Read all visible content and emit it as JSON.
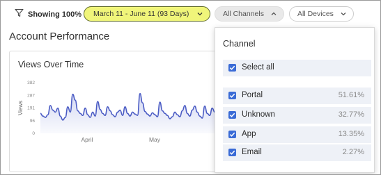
{
  "toolbar": {
    "filter_label": "Showing 100%",
    "date_range": "March 11 - June 11 (93 Days)",
    "channels_label": "All Channels",
    "devices_label": "All Devices"
  },
  "account_performance": {
    "title": "Account Performance"
  },
  "views_card": {
    "title": "Views Over Time"
  },
  "channel_dropdown": {
    "heading": "Channel",
    "select_all_label": "Select all",
    "options": [
      {
        "label": "Portal",
        "percent": "51.61%"
      },
      {
        "label": "Unknown",
        "percent": "32.77%"
      },
      {
        "label": "App",
        "percent": "13.35%"
      },
      {
        "label": "Email",
        "percent": "2.27%"
      }
    ]
  },
  "colors": {
    "date_pill_bg": "#f0f57a",
    "line": "#4a5bc4",
    "checkbox": "#3a6bd6"
  },
  "chart_data": {
    "type": "area",
    "title": "Views Over Time",
    "ylabel": "Views",
    "ytick_labels": [
      "382",
      "287",
      "191",
      "96",
      "0"
    ],
    "ylim": [
      0,
      382
    ],
    "xtick_labels": [
      "April",
      "May"
    ],
    "series": [
      {
        "values": [
          150,
          130,
          120,
          140,
          210,
          175,
          160,
          190,
          130,
          100,
          120,
          200,
          160,
          295,
          250,
          170,
          150,
          135,
          190,
          140,
          120,
          160,
          130,
          240,
          180,
          150,
          135,
          200,
          170,
          140,
          125,
          160,
          175,
          135,
          200,
          150,
          130,
          160,
          145,
          135,
          300,
          230,
          165,
          145,
          130,
          155,
          140,
          125,
          235,
          170,
          150,
          135,
          110,
          125,
          160,
          140,
          125,
          170,
          210,
          150,
          130,
          175,
          205,
          160,
          130,
          115,
          205,
          150,
          135,
          190,
          160,
          120,
          100,
          125,
          205,
          165,
          140,
          125,
          160,
          140,
          110
        ]
      }
    ]
  }
}
